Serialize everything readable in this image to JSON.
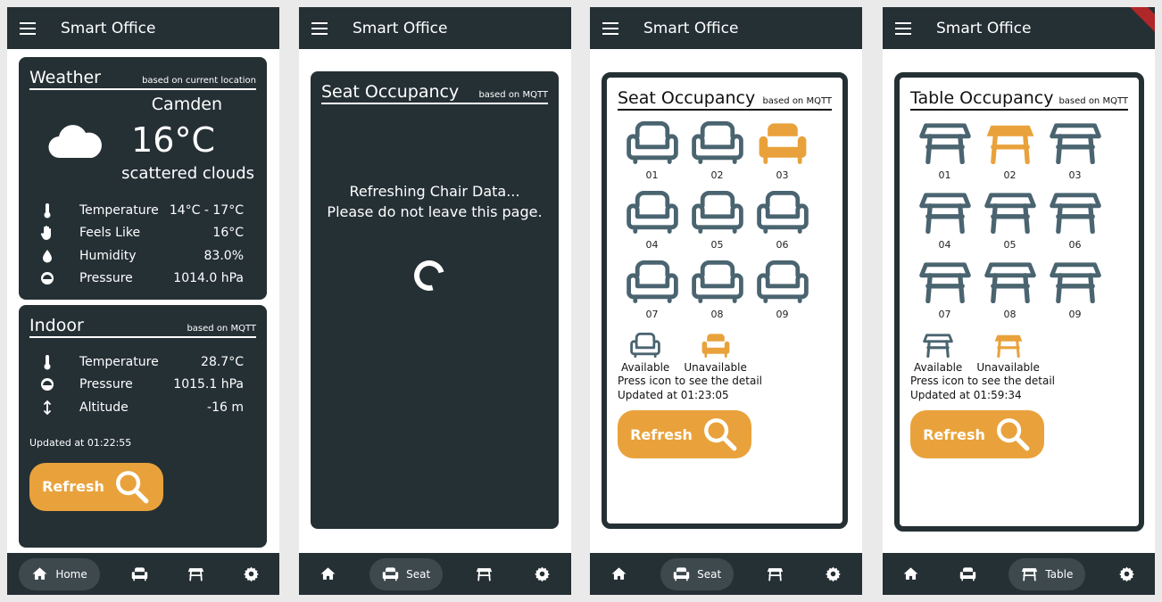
{
  "app_title": "Smart Office",
  "colors": {
    "dark": "#253035",
    "accent": "#e9a23b",
    "chair_available": "#4a6470"
  },
  "nav": {
    "home": "Home",
    "seat": "Seat",
    "table": "Table"
  },
  "refresh_label": "Refresh",
  "weather": {
    "title": "Weather",
    "subtitle": "based on current location",
    "city": "Camden",
    "temp": "16°C",
    "desc": "scattered clouds",
    "rows": [
      {
        "label": "Temperature",
        "value": "14°C - 17°C",
        "icon": "thermometer-icon"
      },
      {
        "label": "Feels Like",
        "value": "16°C",
        "icon": "hand-icon"
      },
      {
        "label": "Humidity",
        "value": "83.0%",
        "icon": "water-drop-icon"
      },
      {
        "label": "Pressure",
        "value": "1014.0 hPa",
        "icon": "pressure-icon"
      }
    ]
  },
  "indoor": {
    "title": "Indoor",
    "subtitle": "based on MQTT",
    "rows": [
      {
        "label": "Temperature",
        "value": "28.7°C",
        "icon": "thermometer-icon"
      },
      {
        "label": "Pressure",
        "value": "1015.1 hPa",
        "icon": "pressure-icon"
      },
      {
        "label": "Altitude",
        "value": "-16 m",
        "icon": "altitude-icon"
      }
    ],
    "updated": "Updated at 01:22:55"
  },
  "loading": {
    "title": "Seat Occupancy",
    "subtitle": "based on MQTT",
    "line1": "Refreshing Chair Data...",
    "line2": "Please do not leave this page."
  },
  "seat": {
    "title": "Seat Occupancy",
    "subtitle": "based on MQTT",
    "items": [
      {
        "label": "01",
        "status": "available"
      },
      {
        "label": "02",
        "status": "available"
      },
      {
        "label": "03",
        "status": "unavailable"
      },
      {
        "label": "04",
        "status": "available"
      },
      {
        "label": "05",
        "status": "available"
      },
      {
        "label": "06",
        "status": "available"
      },
      {
        "label": "07",
        "status": "available"
      },
      {
        "label": "08",
        "status": "available"
      },
      {
        "label": "09",
        "status": "available"
      }
    ],
    "legend_available": "Available",
    "legend_unavailable": "Unavailable",
    "hint": "Press icon to see the detail",
    "updated": "Updated at 01:23:05"
  },
  "table": {
    "title": "Table Occupancy",
    "subtitle": "based on MQTT",
    "items": [
      {
        "label": "01",
        "status": "available"
      },
      {
        "label": "02",
        "status": "unavailable"
      },
      {
        "label": "03",
        "status": "available"
      },
      {
        "label": "04",
        "status": "available"
      },
      {
        "label": "05",
        "status": "available"
      },
      {
        "label": "06",
        "status": "available"
      },
      {
        "label": "07",
        "status": "available"
      },
      {
        "label": "08",
        "status": "available"
      },
      {
        "label": "09",
        "status": "available"
      }
    ],
    "legend_available": "Available",
    "legend_unavailable": "Unavailable",
    "hint": "Press icon to see the detail",
    "updated": "Updated at 01:59:34"
  }
}
